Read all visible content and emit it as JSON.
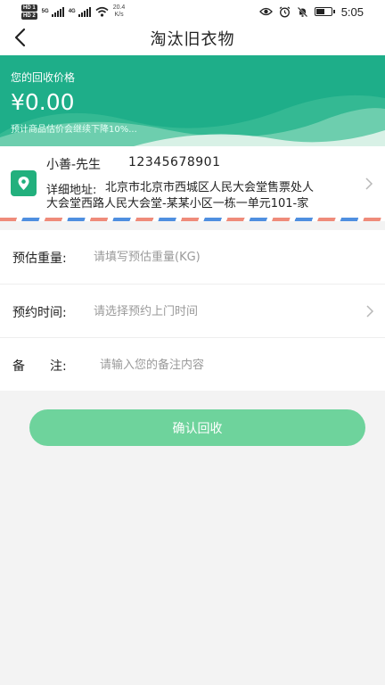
{
  "status_bar": {
    "sim1_label": "HD 1",
    "sim2_label": "HD 2",
    "net1_label": "5G",
    "net2_label": "4G",
    "speed_value": "20.4",
    "speed_unit": "K/s",
    "time": "5:05",
    "battery_level": 0.6,
    "icons": [
      "eye-icon",
      "alarm-icon",
      "mute-bell-icon",
      "battery-icon"
    ]
  },
  "header": {
    "title": "淘汰旧衣物",
    "back_icon": "chevron-left-icon"
  },
  "price_banner": {
    "label": "您的回收价格",
    "value": "¥0.00",
    "note": "预计商品估价会继续下降10%..."
  },
  "address": {
    "name": "小善-先生",
    "phone": "12345678901",
    "detail_label": "详细地址:",
    "detail_line1": "北京市北京市西城区人民大会堂售票处人",
    "detail_line2": "大会堂西路人民大会堂-某某小区一栋一单元101-家",
    "icon": "location-pin-icon",
    "chevron_icon": "chevron-right-icon"
  },
  "form": {
    "weight": {
      "label": "预估重量:",
      "placeholder": "请填写预估重量(KG)"
    },
    "time": {
      "label": "预约时间:",
      "placeholder": "请选择预约上门时间"
    },
    "note": {
      "label": "备　　注:",
      "placeholder": "请输入您的备注内容"
    }
  },
  "confirm_label": "确认回收",
  "colors": {
    "banner": "#1eae89",
    "confirm_button": "#6ed39c",
    "location_icon": "#22b07d",
    "airmail_red": "#ef8b7a",
    "airmail_blue": "#4f8fe0"
  }
}
